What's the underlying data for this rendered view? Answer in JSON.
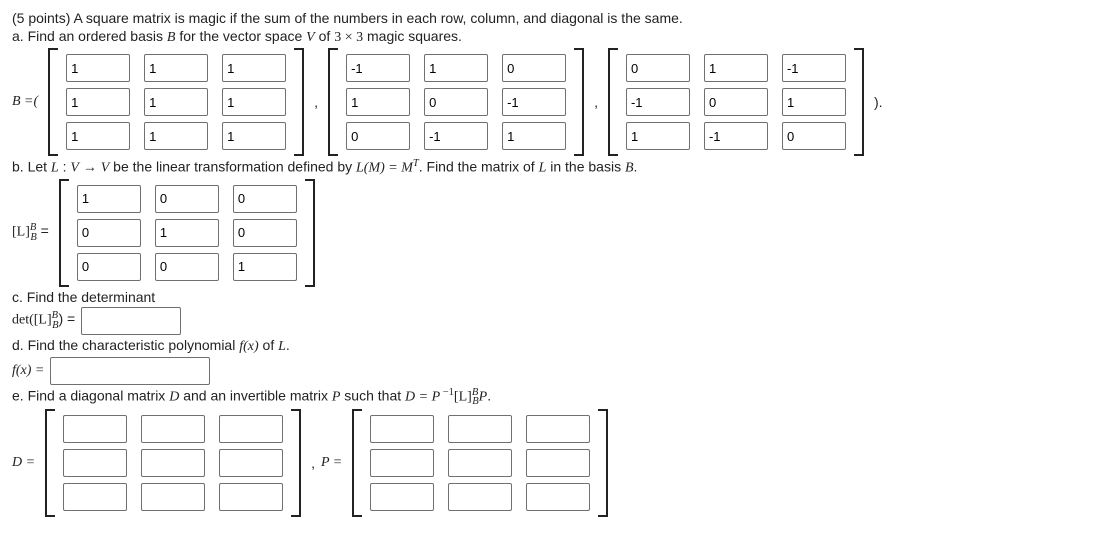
{
  "intro": {
    "points": "(5 points) A square matrix is magic if the sum of the numbers in each row, column, and diagonal is the same.",
    "part_a": "a. Find an ordered basis "
  },
  "basis_text": {
    "B": "B",
    "for_vs": " for the vector space ",
    "V": "V",
    "of": " of ",
    "dim": "3 × 3",
    "magic": " magic squares."
  },
  "B_eq": "B =(",
  "close_paren": ").",
  "comma": ",",
  "matB1": [
    [
      "1",
      "1",
      "1"
    ],
    [
      "1",
      "1",
      "1"
    ],
    [
      "1",
      "1",
      "1"
    ]
  ],
  "matB2": [
    [
      "-1",
      "1",
      "0"
    ],
    [
      "1",
      "0",
      "-1"
    ],
    [
      "0",
      "-1",
      "1"
    ]
  ],
  "matB3": [
    [
      "0",
      "1",
      "-1"
    ],
    [
      "-1",
      "0",
      "1"
    ],
    [
      "1",
      "-1",
      "0"
    ]
  ],
  "part_b": {
    "pre": "b. Let ",
    "L": "L",
    "colon": " : ",
    "V": "V",
    "arrow": " → ",
    "V2": "V",
    "mid": " be the linear transformation defined by ",
    "LM": "L(M) = M",
    "T": "T",
    "tail": ". Find the matrix of ",
    "L2": "L",
    "inbasis": " in the basis ",
    "B": "B",
    "dot": "."
  },
  "LBB_label_pre": "[L]",
  "LBB_sup": "B",
  "LBB_sub": "B",
  "LBB_eq": " =",
  "matL": [
    [
      "1",
      "0",
      "0"
    ],
    [
      "0",
      "1",
      "0"
    ],
    [
      "0",
      "0",
      "1"
    ]
  ],
  "part_c": "c. Find the determinant",
  "det_label_pre": "det([L]",
  "det_eq": ") =",
  "det_val": "",
  "part_d": {
    "pre": "d. Find the characteristic polynomial ",
    "fx": "f(x)",
    "of": " of ",
    "L": "L",
    "dot": "."
  },
  "fx_label": "f(x) =",
  "fx_val": "",
  "part_e": {
    "pre": "e. Find a diagonal matrix ",
    "D": "D",
    "and": " and an invertible matrix ",
    "P": "P",
    "such": " such that ",
    "eq_pre": "D = P",
    "neg1": " −1",
    "LBB": "[L]",
    "sup": "B",
    "sub": "B",
    "Ptail": "P",
    "dot": "."
  },
  "D_label": "D =",
  "P_label": "P =",
  "matD": [
    [
      "",
      "",
      ""
    ],
    [
      "",
      "",
      ""
    ],
    [
      "",
      "",
      ""
    ]
  ],
  "matP": [
    [
      "",
      "",
      ""
    ],
    [
      "",
      "",
      ""
    ],
    [
      "",
      "",
      ""
    ]
  ]
}
